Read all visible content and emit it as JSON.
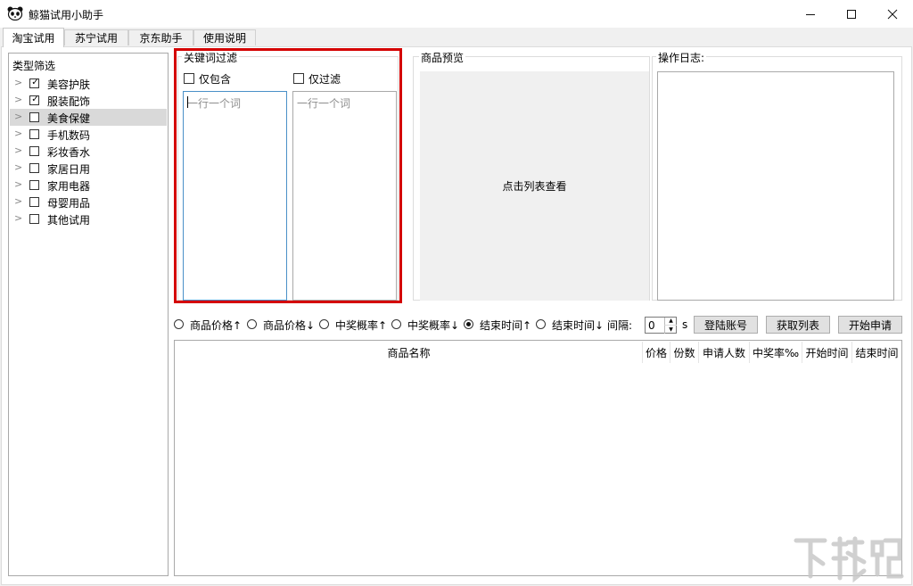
{
  "window": {
    "title": "鲸猫试用小助手",
    "icon": "panda-icon",
    "controls": [
      "minimize-icon",
      "maximize-icon",
      "close-icon"
    ]
  },
  "tabs": [
    {
      "label": "淘宝试用",
      "active": true
    },
    {
      "label": "苏宁试用",
      "active": false
    },
    {
      "label": "京东助手",
      "active": false
    },
    {
      "label": "使用说明",
      "active": false
    }
  ],
  "category_panel": {
    "title": "类型筛选",
    "items": [
      {
        "label": "美容护肤",
        "checked": true,
        "selected": false
      },
      {
        "label": "服装配饰",
        "checked": true,
        "selected": false
      },
      {
        "label": "美食保健",
        "checked": false,
        "selected": true
      },
      {
        "label": "手机数码",
        "checked": false,
        "selected": false
      },
      {
        "label": "彩妆香水",
        "checked": false,
        "selected": false
      },
      {
        "label": "家居日用",
        "checked": false,
        "selected": false
      },
      {
        "label": "家用电器",
        "checked": false,
        "selected": false
      },
      {
        "label": "母婴用品",
        "checked": false,
        "selected": false
      },
      {
        "label": "其他试用",
        "checked": false,
        "selected": false
      }
    ]
  },
  "keyword_filter": {
    "title": "关键词过滤",
    "include_only_label": "仅包含",
    "filter_only_label": "仅过滤",
    "include_placeholder": "一行一个词",
    "filter_placeholder": "一行一个词"
  },
  "preview": {
    "title": "商品预览",
    "hint": "点击列表查看"
  },
  "log": {
    "title": "操作日志:"
  },
  "sort_options": [
    {
      "label": "商品价格↑",
      "selected": false
    },
    {
      "label": "商品价格↓",
      "selected": false
    },
    {
      "label": "中奖概率↑",
      "selected": false
    },
    {
      "label": "中奖概率↓",
      "selected": false
    },
    {
      "label": "结束时间↑",
      "selected": true
    },
    {
      "label": "结束时间↓",
      "selected": false
    }
  ],
  "interval": {
    "label": "间隔:",
    "value": "0",
    "unit": "s"
  },
  "buttons": {
    "login": "登陆账号",
    "fetch": "获取列表",
    "start": "开始申请"
  },
  "table": {
    "columns": [
      "商品名称",
      "价格",
      "份数",
      "申请人数",
      "中奖率‰",
      "开始时间",
      "结束时间"
    ]
  },
  "colors": {
    "highlight_border": "#d40000",
    "selected_row": "#d9d9d9"
  }
}
